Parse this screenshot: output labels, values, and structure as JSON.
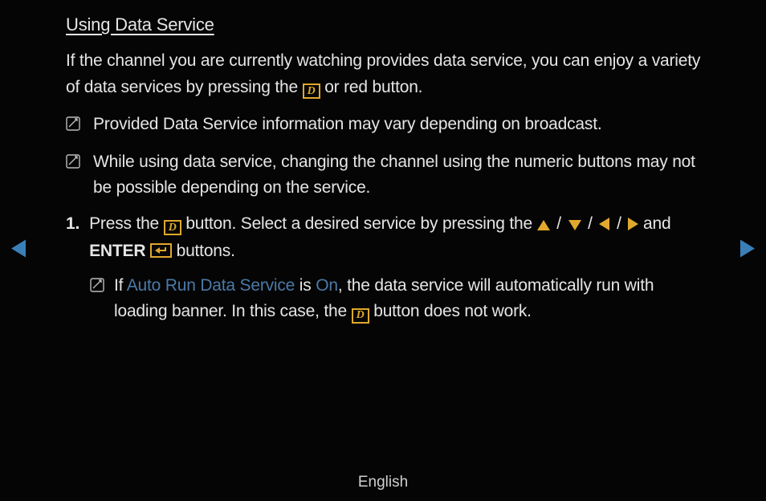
{
  "title": "Using Data Service",
  "intro_part1": "If the channel you are currently watching provides data service, you can enjoy a variety of data services by pressing the ",
  "intro_part2": " or red button.",
  "note1": "Provided Data Service information may vary depending on broadcast.",
  "note2": "While using data service, changing the channel using the numeric buttons may not be possible depending on the service.",
  "step1_num": "1.",
  "step1_a": "Press the ",
  "step1_b": " button. Select a desired service by pressing the ",
  "slash": "/",
  "step1_c": " and ",
  "enter_label": "ENTER",
  "step1_d": " buttons.",
  "subnote_a": "If ",
  "auto_run": "Auto Run Data Service",
  "subnote_b": " is ",
  "on_label": "On",
  "subnote_c": ", the data service will automatically run with loading banner. In this case, the ",
  "subnote_d": " button does not work.",
  "lang": "English",
  "d_glyph": "D"
}
